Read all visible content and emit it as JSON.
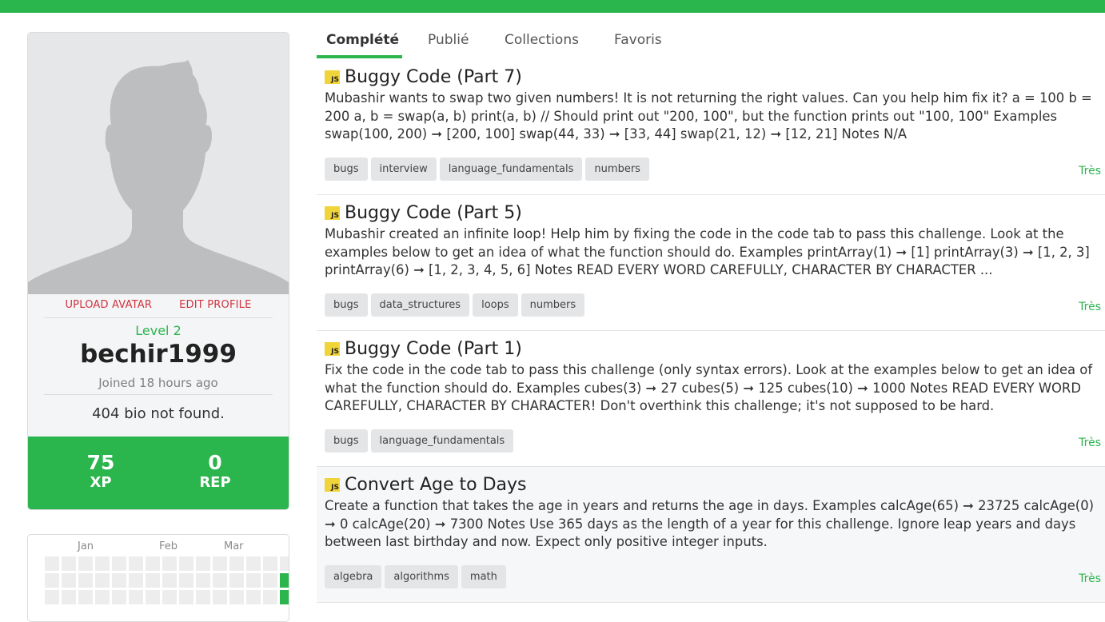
{
  "colors": {
    "accent": "#2ab54d",
    "link_red": "#d0333f",
    "js_badge": "#f0d43a"
  },
  "profile": {
    "avatar_alt": "default avatar silhouette",
    "upload_avatar": "UPLOAD AVATAR",
    "edit_profile": "EDIT PROFILE",
    "level": "Level 2",
    "username": "bechir1999",
    "joined": "Joined 18 hours ago",
    "bio": "404 bio not found.",
    "xp_value": "75",
    "xp_label": "XP",
    "rep_value": "0",
    "rep_label": "REP"
  },
  "calendar": {
    "months": [
      "Jan",
      "Feb",
      "Mar"
    ]
  },
  "tabs": [
    {
      "label": "Complété",
      "active": true
    },
    {
      "label": "Publié",
      "active": false
    },
    {
      "label": "Collections",
      "active": false
    },
    {
      "label": "Favoris",
      "active": false
    }
  ],
  "challenges": [
    {
      "lang_badge": "JS",
      "title": "Buggy Code (Part 7)",
      "description": "Mubashir wants to swap two given numbers! It is not returning the right values. Can you help him fix it? a = 100 b = 200 a, b = swap(a, b) print(a, b) // Should print out \"200, 100\", but the function prints out \"100, 100\" Examples swap(100, 200) ➞ [200, 100] swap(44, 33) ➞ [33, 44] swap(21, 12) ➞ [12, 21] Notes N/A",
      "tags": [
        "bugs",
        "interview",
        "language_fundamentals",
        "numbers"
      ],
      "difficulty": "Très"
    },
    {
      "lang_badge": "JS",
      "title": "Buggy Code (Part 5)",
      "description": "Mubashir created an infinite loop! Help him by fixing the code in the code tab to pass this challenge. Look at the examples below to get an idea of what the function should do. Examples printArray(1) ➞ [1] printArray(3) ➞ [1, 2, 3] printArray(6) ➞ [1, 2, 3, 4, 5, 6] Notes READ EVERY WORD CAREFULLY, CHARACTER BY CHARACTER ...",
      "tags": [
        "bugs",
        "data_structures",
        "loops",
        "numbers"
      ],
      "difficulty": "Très"
    },
    {
      "lang_badge": "JS",
      "title": "Buggy Code (Part 1)",
      "description": "Fix the code in the code tab to pass this challenge (only syntax errors). Look at the examples below to get an idea of what the function should do. Examples cubes(3) ➞ 27 cubes(5) ➞ 125 cubes(10) ➞ 1000 Notes READ EVERY WORD CAREFULLY, CHARACTER BY CHARACTER! Don't overthink this challenge; it's not supposed to be hard.",
      "tags": [
        "bugs",
        "language_fundamentals"
      ],
      "difficulty": "Très"
    },
    {
      "lang_badge": "JS",
      "title": "Convert Age to Days",
      "description": "Create a function that takes the age in years and returns the age in days. Examples calcAge(65) ➞ 23725 calcAge(0) ➞ 0 calcAge(20) ➞ 7300 Notes Use 365 days as the length of a year for this challenge. Ignore leap years and days between last birthday and now. Expect only positive integer inputs.",
      "tags": [
        "algebra",
        "algorithms",
        "math"
      ],
      "difficulty": "Très"
    }
  ]
}
